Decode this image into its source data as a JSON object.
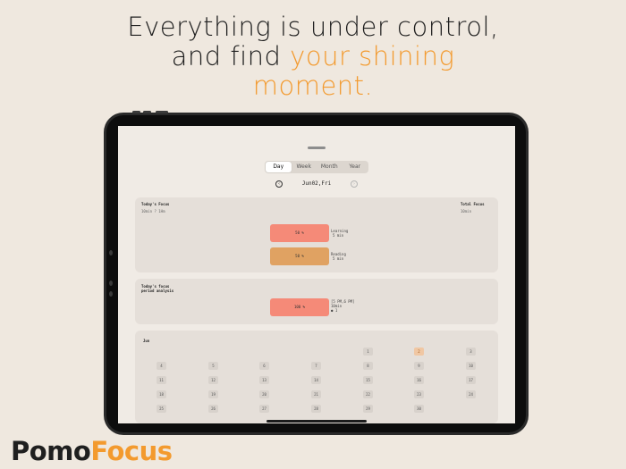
{
  "headline": {
    "line1": "Everything is under control,",
    "line2_plain": "and find ",
    "line2_accent": "your shining",
    "line3_accent": "moment."
  },
  "app": {
    "tabs": [
      "Day",
      "Week",
      "Month",
      "Year"
    ],
    "active_tab": "Day",
    "date_label": "Jun02,Fri",
    "today_focus": {
      "title": "Today's Focus",
      "subtitle": "10min ? 1Hm",
      "total_label": "Total Focus",
      "total_value": "10min",
      "bars": [
        {
          "text": "50 %",
          "legend_line1": "Learning",
          "legend_line2": "5 min",
          "color": "#f58a78"
        },
        {
          "text": "50 %",
          "legend_line1": "Reading",
          "legend_line2": "5 min",
          "color": "#e0a262"
        }
      ]
    },
    "period": {
      "title_line1": "Today's focus",
      "title_line2": "period analysis",
      "bar_text": "100 %",
      "legend_line1": "[5 PM,6 PM]",
      "legend_line2": "10min",
      "legend_line3": "● 1",
      "color": "#f58a78"
    },
    "calendar": {
      "month": "Jun",
      "highlight_day": "2",
      "highlight_color": "#f0c7a3",
      "rows": [
        [
          "",
          "",
          "",
          "",
          "1",
          "2",
          "3"
        ],
        [
          "4",
          "5",
          "6",
          "7",
          "8",
          "9",
          "10"
        ],
        [
          "11",
          "12",
          "13",
          "14",
          "15",
          "16",
          "17"
        ],
        [
          "18",
          "19",
          "20",
          "21",
          "22",
          "23",
          "24"
        ],
        [
          "25",
          "26",
          "27",
          "28",
          "29",
          "30",
          ""
        ]
      ]
    }
  },
  "brand": {
    "part1": "Pomo",
    "part2": "Focus"
  },
  "colors": {
    "accent": "#f39a2e",
    "background": "#efe8df"
  }
}
